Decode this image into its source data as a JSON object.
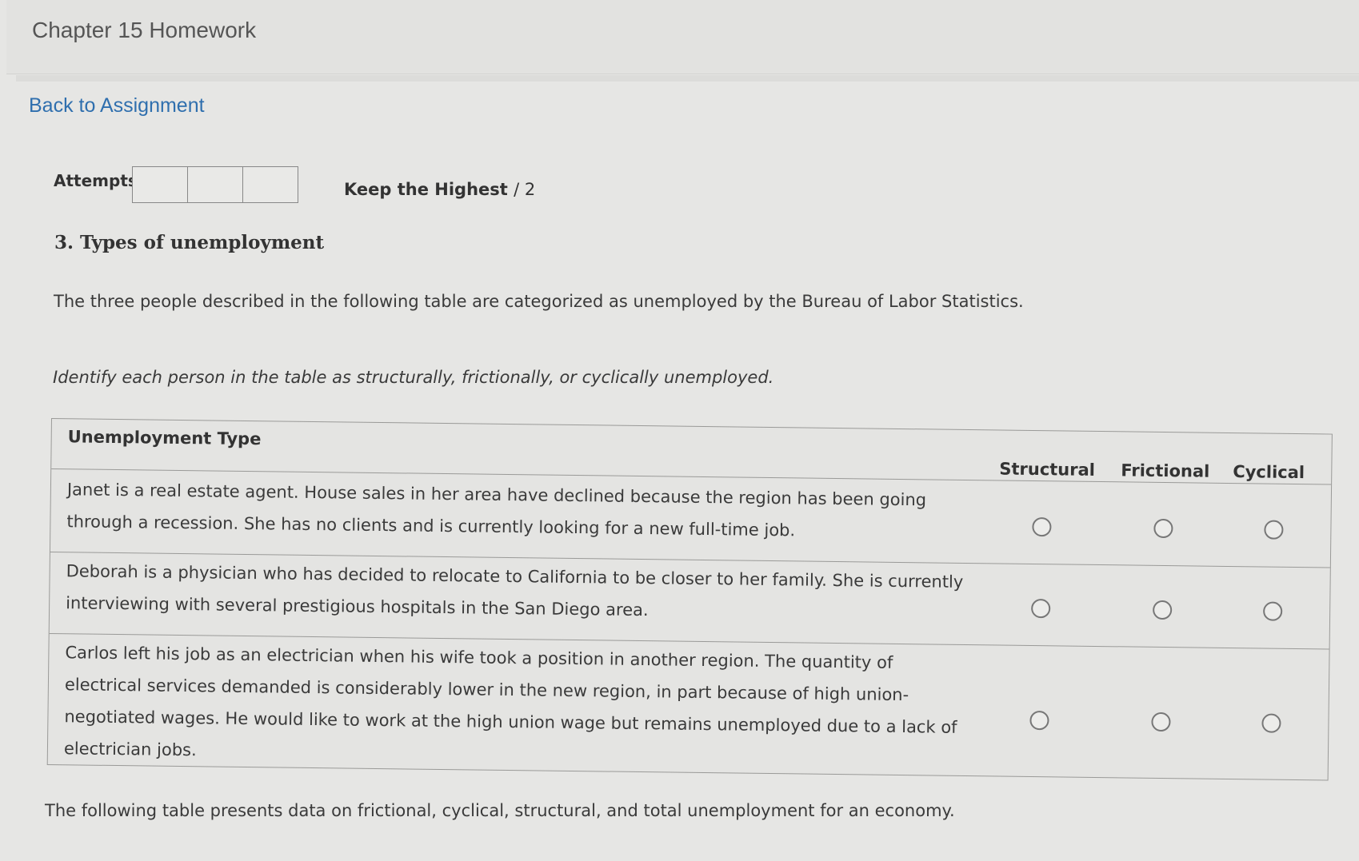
{
  "header": {
    "title": "Chapter 15 Homework"
  },
  "nav": {
    "back_label": "Back to Assignment"
  },
  "attempts": {
    "label": "Attempts",
    "boxes": [
      "",
      "",
      ""
    ],
    "keep_label": "Keep the Highest",
    "keep_denominator": "/ 2"
  },
  "question": {
    "title": "3. Types of unemployment",
    "intro": "The three people described in the following table are categorized as unemployed by the Bureau of Labor Statistics.",
    "instructions": "Identify each person in the table as structurally, frictionally, or cyclically unemployed."
  },
  "table": {
    "type_header": "Unemployment Type",
    "columns": [
      "Structural",
      "Frictional",
      "Cyclical"
    ],
    "rows": [
      {
        "lines": [
          "Janet is a real estate agent. House sales in her area have declined because the region has been going",
          "through a recession. She has no clients and is currently looking for a new full-time job."
        ],
        "selected": null
      },
      {
        "lines": [
          "Deborah is a physician who has decided to relocate to California to be closer to her family. She is currently",
          "interviewing with several prestigious hospitals in the San Diego area."
        ],
        "selected": null
      },
      {
        "lines": [
          "Carlos left his job as an electrician when his wife took a position in another region. The quantity of",
          "electrical services demanded is considerably lower in the new region, in part because of high union-",
          "negotiated wages. He would like to work at the high union wage but remains unemployed due to a lack of",
          "electrician jobs."
        ],
        "selected": null
      }
    ]
  },
  "footer": {
    "text": "The following table presents data on frictional, cyclical, structural, and total unemployment for an economy."
  }
}
